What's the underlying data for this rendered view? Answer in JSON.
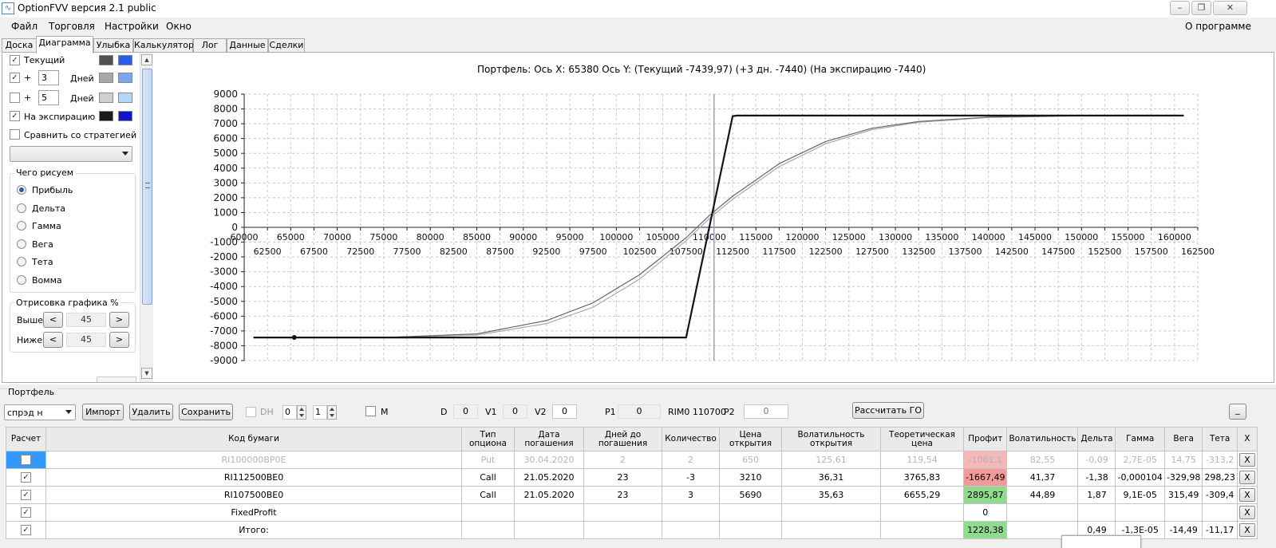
{
  "window": {
    "title": "OptionFVV версия 2.1 public"
  },
  "menu": {
    "items": [
      "Файл",
      "Торговля",
      "Настройки",
      "Окно"
    ],
    "about": "О программе"
  },
  "tabs": [
    "Доска",
    "Диаграмма",
    "Улыбка",
    "Калькулятор",
    "Лог",
    "Данные",
    "Сделки"
  ],
  "active_tab": "Диаграмма",
  "left": {
    "current_label": "Текущий",
    "plus": "+",
    "days_label": "Дней",
    "days1": "3",
    "days2": "5",
    "expiry_label": "На экспирацию",
    "compare_label": "Сравнить со стратегией",
    "draw_group": "Чего рисуем",
    "draw_options": [
      "Прибыль",
      "Дельта",
      "Гамма",
      "Вега",
      "Тета",
      "Вомма"
    ],
    "render_group": "Отрисовка графика %",
    "above_label": "Выше",
    "below_label": "Ниже",
    "above_value": "45",
    "below_value": "45",
    "arrow_left": "<",
    "arrow_right": ">",
    "colors": {
      "current_dark": "#505050",
      "current_light": "#2a5cf0",
      "d3_dark": "#a8a8a8",
      "d3_light": "#7ca6f0",
      "d5_dark": "#cfcfcf",
      "d5_light": "#b4d6f8",
      "exp_dark": "#1c1c1c",
      "exp_light": "#1414c8"
    }
  },
  "chart": {
    "title": "Портфель: Ось X: 65380 Ось Y:  (Текущий -7439,97)  (+3 дн. -7440)  (На экспирацию -7440)"
  },
  "chart_data": {
    "type": "line",
    "title": "Портфель: Ось X: 65380 Ось Y:  (Текущий -7439,97)  (+3 дн. -7440)  (На экспирацию -7440)",
    "xlim": [
      60000,
      162500
    ],
    "ylim": [
      -9000,
      9000
    ],
    "xticks_top": [
      60000,
      65000,
      70000,
      75000,
      80000,
      85000,
      90000,
      95000,
      100000,
      105000,
      110000,
      115000,
      120000,
      125000,
      130000,
      135000,
      140000,
      145000,
      150000,
      155000,
      160000
    ],
    "xticks_bottom": [
      62500,
      67500,
      72500,
      77500,
      82500,
      87500,
      92500,
      97500,
      102500,
      107500,
      112500,
      117500,
      122500,
      127500,
      132500,
      137500,
      142500,
      147500,
      152500,
      157500,
      162500
    ],
    "yticks": [
      9000,
      8000,
      7000,
      6000,
      5000,
      4000,
      3000,
      2000,
      1000,
      0,
      -1000,
      -2000,
      -3000,
      -4000,
      -5000,
      -6000,
      -7000,
      -8000,
      -9000
    ],
    "grid": true,
    "cursor_x": 110500,
    "marker": {
      "x": 65380,
      "y": -7440
    },
    "series": [
      {
        "color": "#151515",
        "x": [
          61000,
          107500,
          112500,
          113000,
          161000
        ],
        "y": [
          -7440,
          -7440,
          7510,
          7550,
          7550
        ]
      },
      {
        "color": "#666666",
        "x": [
          61000,
          75000,
          85000,
          92500,
          97500,
          102500,
          107500,
          110000,
          112500,
          117500,
          122500,
          127500,
          132500,
          140000,
          150000,
          161000
        ],
        "y": [
          -7440,
          -7440,
          -7200,
          -6300,
          -5100,
          -3200,
          -700,
          800,
          2100,
          4300,
          5800,
          6700,
          7150,
          7450,
          7540,
          7550
        ]
      },
      {
        "color": "#aaaaaa",
        "x": [
          61000,
          75000,
          85000,
          92500,
          97500,
          102500,
          107500,
          110000,
          112500,
          117500,
          122500,
          127500,
          132500,
          140000,
          150000,
          161000
        ],
        "y": [
          -7440,
          -7440,
          -7280,
          -6500,
          -5400,
          -3500,
          -900,
          600,
          1900,
          4100,
          5650,
          6600,
          7100,
          7420,
          7535,
          7550
        ]
      }
    ]
  },
  "portfolio": {
    "group_label": "Портфель",
    "combo_value": "спрэд н",
    "import": "Импорт",
    "delete": "Удалить",
    "save": "Сохранить",
    "dh": "DH",
    "dh_v1": "0",
    "dh_v2": "1",
    "m": "M",
    "d_label": "D",
    "d_value": "0",
    "v1_label": "V1",
    "v1_value": "0",
    "v2_label": "V2",
    "v2_value": "0",
    "p1_label": "P1",
    "p1_value": "0",
    "rim": "RIM0 110700",
    "p2_label": "P2",
    "p2_value": "0",
    "calc_go": "Рассчитать ГО",
    "minimize": "_"
  },
  "table": {
    "headers": [
      "Расчет",
      "Код бумаги",
      "Тип\nопциона",
      "Дата\nпогашения",
      "Дней до\nпогашения",
      "Количество",
      "Цена\nоткрытия",
      "Волатильность\nоткрытия",
      "Теоретическая\nцена",
      "Профит",
      "Волатильность",
      "Дельта",
      "Гамма",
      "Вега",
      "Тета",
      "X"
    ],
    "rows": [
      {
        "checked": false,
        "code": "RI100000BP0E",
        "type": "Put",
        "date": "30.04.2020",
        "days": "2",
        "qty": "2",
        "price": "650",
        "vol_open": "125,61",
        "theor": "119,54",
        "profit": "-1061,1",
        "vol": "82,55",
        "delta": "-0,09",
        "gamma": "2,7E-05",
        "vega": "14,75",
        "theta": "-313,2",
        "x": "X",
        "profit_bg": "#f5b7b7"
      },
      {
        "checked": true,
        "code": "RI112500BE0",
        "type": "Call",
        "date": "21.05.2020",
        "days": "23",
        "qty": "-3",
        "price": "3210",
        "vol_open": "36,31",
        "theor": "3765,83",
        "profit": "-1667,49",
        "vol": "41,37",
        "delta": "-1,38",
        "gamma": "-0,000104",
        "vega": "-329,98",
        "theta": "298,23",
        "x": "X",
        "profit_bg": "#f29a9a"
      },
      {
        "checked": true,
        "code": "RI107500BE0",
        "type": "Call",
        "date": "21.05.2020",
        "days": "23",
        "qty": "3",
        "price": "5690",
        "vol_open": "35,63",
        "theor": "6655,29",
        "profit": "2895,87",
        "vol": "44,89",
        "delta": "1,87",
        "gamma": "9,1E-05",
        "vega": "315,49",
        "theta": "-309,4",
        "x": "X",
        "profit_bg": "#8fdc8f"
      },
      {
        "checked": true,
        "code": "FixedProfit",
        "type": "",
        "date": "",
        "days": "",
        "qty": "",
        "price": "",
        "vol_open": "",
        "theor": "",
        "profit": "0",
        "vol": "",
        "delta": "",
        "gamma": "",
        "vega": "",
        "theta": "",
        "x": "X",
        "profit_bg": "#ffffff"
      },
      {
        "checked": true,
        "code": "Итого:",
        "type": "",
        "date": "",
        "days": "",
        "qty": "",
        "price": "",
        "vol_open": "",
        "theor": "",
        "profit": "1228,38",
        "vol": "",
        "delta": "0,49",
        "gamma": "-1,3E-05",
        "vega": "-14,49",
        "theta": "-11,17",
        "x": "X",
        "profit_bg": "#8fdc8f"
      }
    ]
  }
}
